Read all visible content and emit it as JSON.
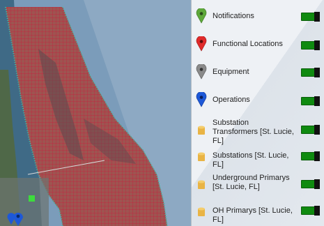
{
  "layers": [
    {
      "label": "Notifications",
      "icon": "green-pin-icon",
      "color": "#5ea83a",
      "enabled": true
    },
    {
      "label": "Functional Locations",
      "icon": "red-pin-icon",
      "color": "#e02b2b",
      "enabled": true
    },
    {
      "label": "Equipment",
      "icon": "gray-pin-icon",
      "color": "#8a8a8a",
      "enabled": true
    },
    {
      "label": "Operations",
      "icon": "blue-pin-icon",
      "color": "#1d58d8",
      "enabled": true
    },
    {
      "label": "Substation Transformers [St. Lucie, FL]",
      "icon": "database-icon",
      "color": "#e9b445",
      "enabled": true
    },
    {
      "label": "Substations [St. Lucie, FL]",
      "icon": "database-icon",
      "color": "#e9b445",
      "enabled": true
    },
    {
      "label": "Underground Primarys [St. Lucie, FL]",
      "icon": "database-icon",
      "color": "#e9b445",
      "enabled": true
    },
    {
      "label": "OH Primarys [St. Lucie, FL]",
      "icon": "database-icon",
      "color": "#e9b445",
      "enabled": true
    }
  ],
  "colors": {
    "toggle_on": "#0f8a10",
    "ocean": "#6f94b4",
    "lagoon": "#3f6a86",
    "land": "#8a6d5a",
    "grid_overlay": "#c81e3c",
    "marker_green": "#3ddc3d",
    "marker_blue": "#1d58d8"
  }
}
